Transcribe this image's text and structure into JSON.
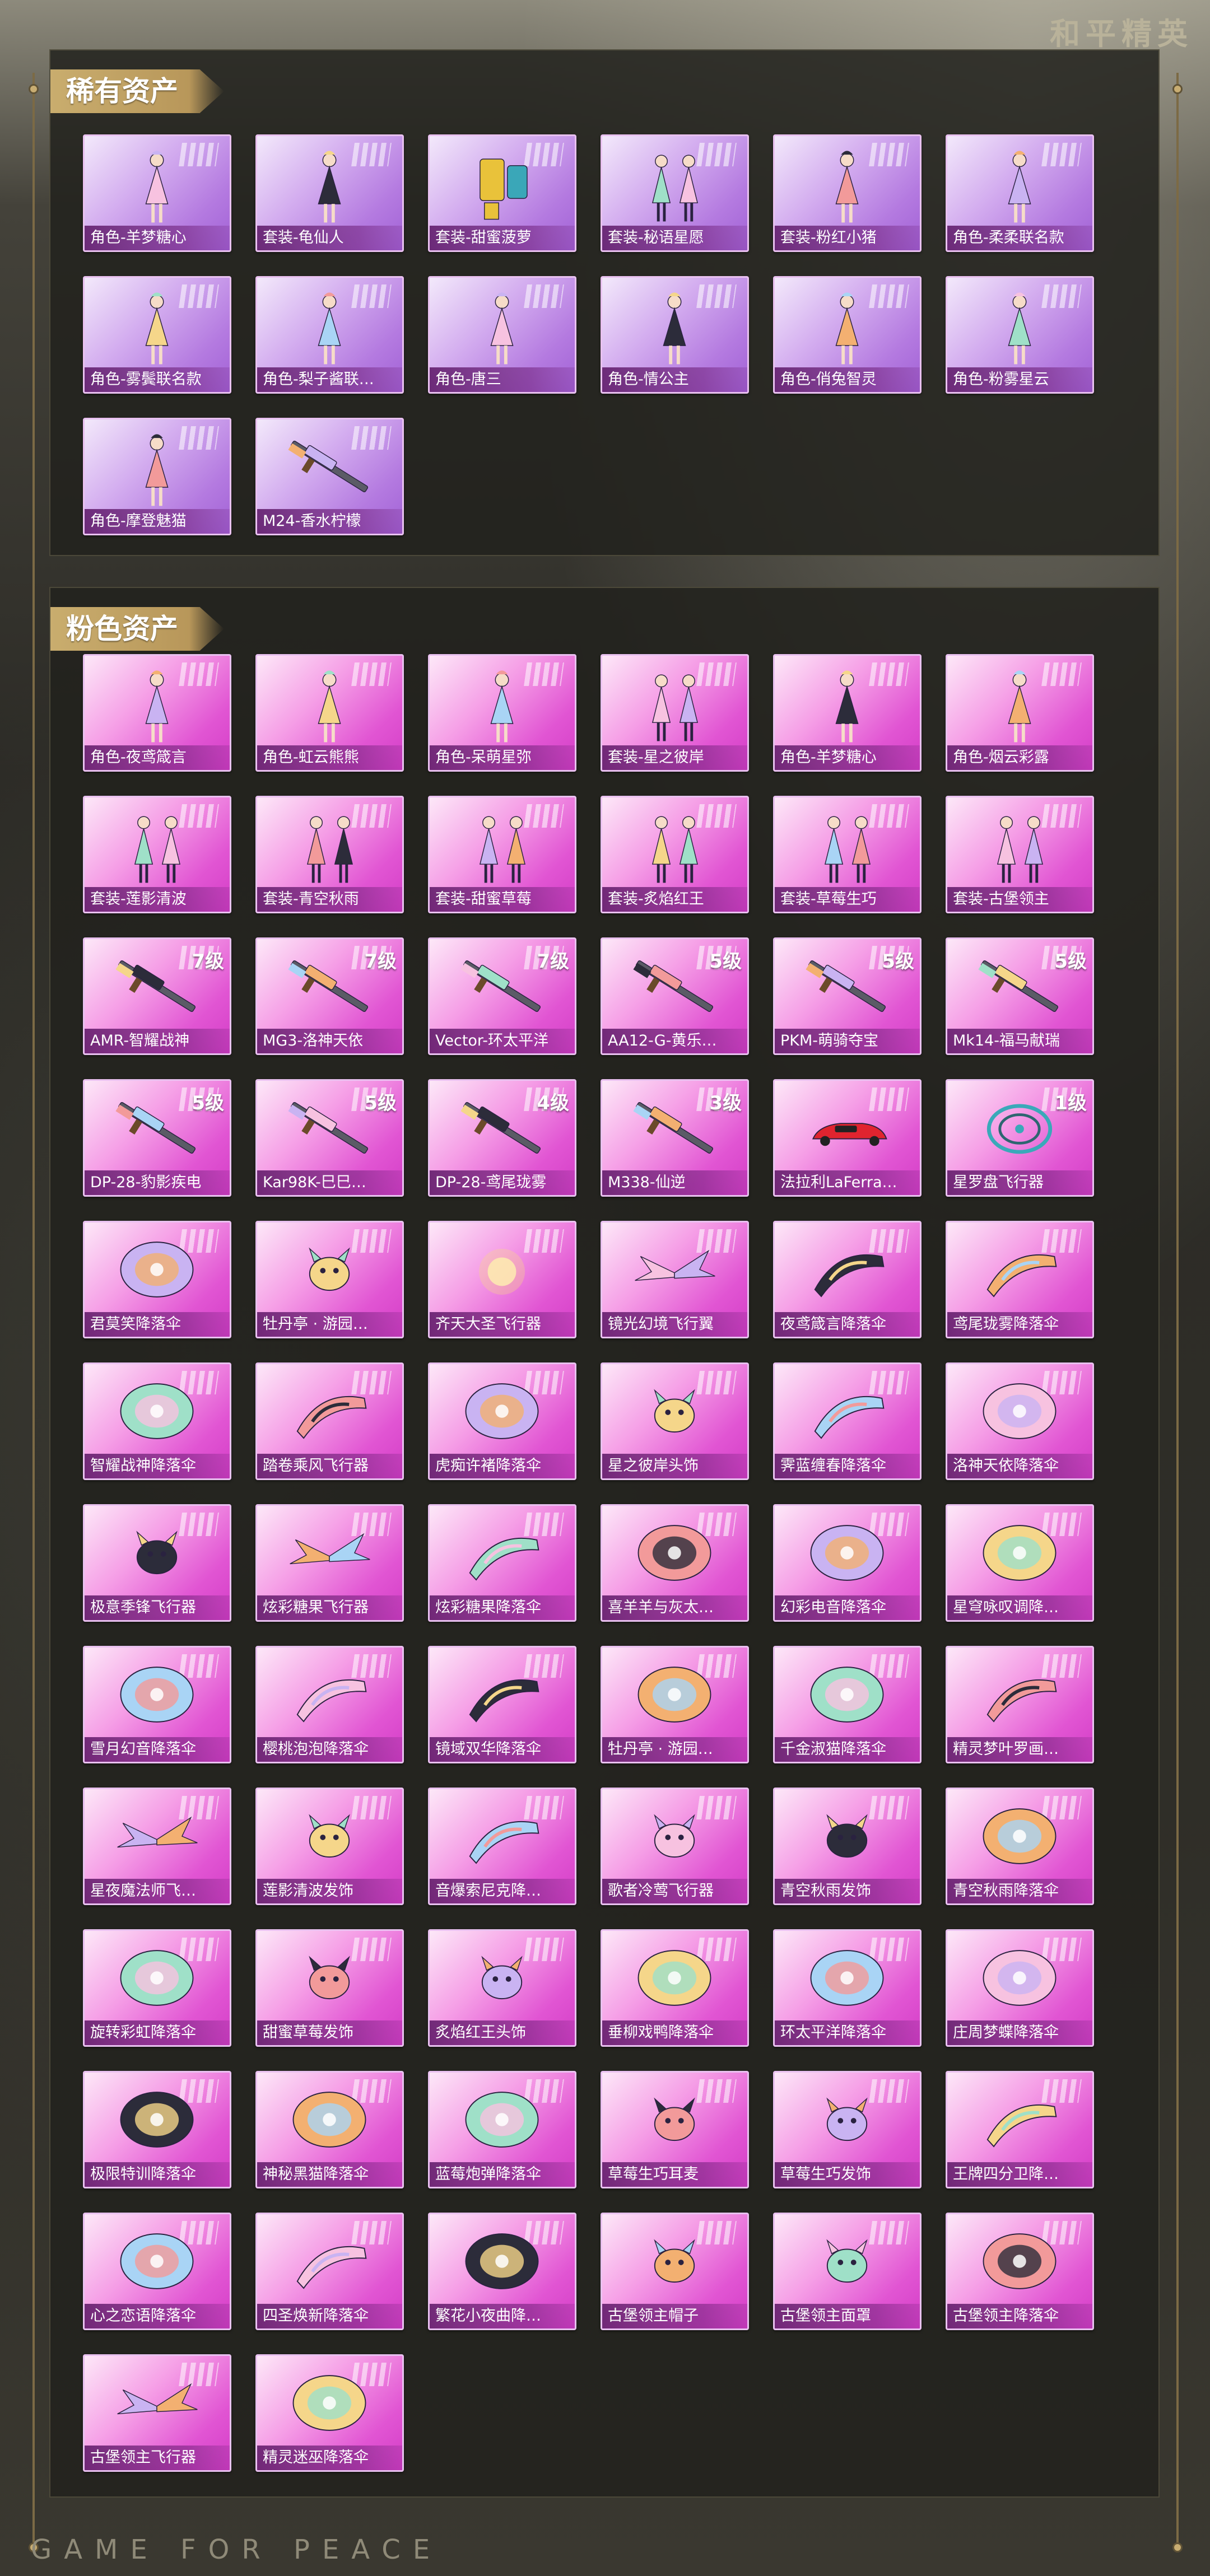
{
  "header": {
    "brand_title": "和平精英"
  },
  "footer": {
    "brand_text": "GAME FOR PEACE"
  },
  "rare_section": {
    "title": "稀有资产",
    "items": [
      {
        "label": "角色-羊梦糖心",
        "type": "character",
        "level": ""
      },
      {
        "label": "套装-龟仙人",
        "type": "character",
        "level": ""
      },
      {
        "label": "套装-甜蜜菠萝",
        "type": "outfit",
        "level": ""
      },
      {
        "label": "套装-秘语星愿",
        "type": "pair",
        "level": ""
      },
      {
        "label": "套装-粉红小猪",
        "type": "character",
        "level": ""
      },
      {
        "label": "角色-柔柔联名款",
        "type": "character",
        "level": ""
      },
      {
        "label": "角色-雾鬓联名款",
        "type": "character",
        "level": ""
      },
      {
        "label": "角色-梨子酱联…",
        "type": "character",
        "level": ""
      },
      {
        "label": "角色-唐三",
        "type": "character",
        "level": ""
      },
      {
        "label": "角色-情公主",
        "type": "character",
        "level": ""
      },
      {
        "label": "角色-俏兔智灵",
        "type": "character",
        "level": ""
      },
      {
        "label": "角色-粉雾星云",
        "type": "character",
        "level": ""
      },
      {
        "label": "角色-摩登魅猫",
        "type": "character",
        "level": ""
      },
      {
        "label": "M24-香水柠檬",
        "type": "gun",
        "level": ""
      }
    ]
  },
  "pink_section": {
    "title": "粉色资产",
    "items": [
      {
        "label": "角色-夜鸢箴言",
        "type": "character",
        "level": ""
      },
      {
        "label": "角色-虹云熊熊",
        "type": "character",
        "level": ""
      },
      {
        "label": "角色-呆萌星弥",
        "type": "character",
        "level": ""
      },
      {
        "label": "套装-星之彼岸",
        "type": "pair",
        "level": ""
      },
      {
        "label": "角色-羊梦糖心",
        "type": "character",
        "level": ""
      },
      {
        "label": "角色-烟云彩露",
        "type": "character",
        "level": ""
      },
      {
        "label": "套装-莲影清波",
        "type": "pair",
        "level": ""
      },
      {
        "label": "套装-青空秋雨",
        "type": "pair",
        "level": ""
      },
      {
        "label": "套装-甜蜜草莓",
        "type": "pair",
        "level": ""
      },
      {
        "label": "套装-炙焰红王",
        "type": "pair",
        "level": ""
      },
      {
        "label": "套装-草莓生巧",
        "type": "pair",
        "level": ""
      },
      {
        "label": "套装-古堡领主",
        "type": "pair",
        "level": ""
      },
      {
        "label": "AMR-智耀战神",
        "type": "gun",
        "level": "7级"
      },
      {
        "label": "MG3-洛神天依",
        "type": "gun",
        "level": "7级"
      },
      {
        "label": "Vector-环太平洋",
        "type": "gun",
        "level": "7级"
      },
      {
        "label": "AA12-G-黄乐…",
        "type": "gun",
        "level": "5级"
      },
      {
        "label": "PKM-萌骑夺宝",
        "type": "gun",
        "level": "5级"
      },
      {
        "label": "Mk14-福马献瑞",
        "type": "gun",
        "level": "5级"
      },
      {
        "label": "DP-28-豹影疾电",
        "type": "gun",
        "level": "5级"
      },
      {
        "label": "Kar98K-巳巳…",
        "type": "gun",
        "level": "5级"
      },
      {
        "label": "DP-28-鸢尾珑雾",
        "type": "gun",
        "level": "4级"
      },
      {
        "label": "M338-仙逆",
        "type": "gun",
        "level": "3级"
      },
      {
        "label": "法拉利LaFerra…",
        "type": "car",
        "level": ""
      },
      {
        "label": "星罗盘飞行器",
        "type": "ring",
        "level": "1级"
      },
      {
        "label": "君莫笑降落伞",
        "type": "parachute",
        "level": ""
      },
      {
        "label": "牡丹亭 · 游园…",
        "type": "creature",
        "level": ""
      },
      {
        "label": "齐天大圣飞行器",
        "type": "glow",
        "level": ""
      },
      {
        "label": "镜光幻境飞行翼",
        "type": "wing",
        "level": ""
      },
      {
        "label": "夜鸢箴言降落伞",
        "type": "glider",
        "level": ""
      },
      {
        "label": "鸢尾珑雾降落伞",
        "type": "glider",
        "level": ""
      },
      {
        "label": "智耀战神降落伞",
        "type": "parachute",
        "level": ""
      },
      {
        "label": "踏卷乘风飞行器",
        "type": "glider",
        "level": ""
      },
      {
        "label": "虎痴许褚降落伞",
        "type": "parachute",
        "level": ""
      },
      {
        "label": "星之彼岸头饰",
        "type": "creature",
        "level": ""
      },
      {
        "label": "霁蓝缠春降落伞",
        "type": "glider",
        "level": ""
      },
      {
        "label": "洛神天依降落伞",
        "type": "parachute",
        "level": ""
      },
      {
        "label": "极意季锋飞行器",
        "type": "creature",
        "level": ""
      },
      {
        "label": "炫彩糖果飞行器",
        "type": "wing",
        "level": ""
      },
      {
        "label": "炫彩糖果降落伞",
        "type": "glider",
        "level": ""
      },
      {
        "label": "喜羊羊与灰太…",
        "type": "parachute",
        "level": ""
      },
      {
        "label": "幻彩电音降落伞",
        "type": "parachute",
        "level": ""
      },
      {
        "label": "星穹咏叹调降…",
        "type": "parachute",
        "level": ""
      },
      {
        "label": "雪月幻音降落伞",
        "type": "parachute",
        "level": ""
      },
      {
        "label": "樱桃泡泡降落伞",
        "type": "glider",
        "level": ""
      },
      {
        "label": "镜域双华降落伞",
        "type": "glider",
        "level": ""
      },
      {
        "label": "牡丹亭 · 游园…",
        "type": "parachute",
        "level": ""
      },
      {
        "label": "千金淑猫降落伞",
        "type": "parachute",
        "level": ""
      },
      {
        "label": "精灵梦叶罗画…",
        "type": "glider",
        "level": ""
      },
      {
        "label": "星夜魔法师飞…",
        "type": "wing",
        "level": ""
      },
      {
        "label": "莲影清波发饰",
        "type": "creature",
        "level": ""
      },
      {
        "label": "音爆索尼克降…",
        "type": "glider",
        "level": ""
      },
      {
        "label": "歌者冷莺飞行器",
        "type": "creature",
        "level": ""
      },
      {
        "label": "青空秋雨发饰",
        "type": "creature",
        "level": ""
      },
      {
        "label": "青空秋雨降落伞",
        "type": "parachute",
        "level": ""
      },
      {
        "label": "旋转彩虹降落伞",
        "type": "parachute",
        "level": ""
      },
      {
        "label": "甜蜜草莓发饰",
        "type": "creature",
        "level": ""
      },
      {
        "label": "炙焰红王头饰",
        "type": "creature",
        "level": ""
      },
      {
        "label": "垂柳戏鸭降落伞",
        "type": "parachute",
        "level": ""
      },
      {
        "label": "环太平洋降落伞",
        "type": "parachute",
        "level": ""
      },
      {
        "label": "庄周梦蝶降落伞",
        "type": "parachute",
        "level": ""
      },
      {
        "label": "极限特训降落伞",
        "type": "parachute",
        "level": ""
      },
      {
        "label": "神秘黑猫降落伞",
        "type": "parachute",
        "level": ""
      },
      {
        "label": "蓝莓炮弹降落伞",
        "type": "parachute",
        "level": ""
      },
      {
        "label": "草莓生巧耳麦",
        "type": "creature",
        "level": ""
      },
      {
        "label": "草莓生巧发饰",
        "type": "creature",
        "level": ""
      },
      {
        "label": "王牌四分卫降…",
        "type": "glider",
        "level": ""
      },
      {
        "label": "心之恋语降落伞",
        "type": "parachute",
        "level": ""
      },
      {
        "label": "四圣焕新降落伞",
        "type": "glider",
        "level": ""
      },
      {
        "label": "繁花小夜曲降…",
        "type": "parachute",
        "level": ""
      },
      {
        "label": "古堡领主帽子",
        "type": "creature",
        "level": ""
      },
      {
        "label": "古堡领主面罩",
        "type": "creature",
        "level": ""
      },
      {
        "label": "古堡领主降落伞",
        "type": "parachute",
        "level": ""
      },
      {
        "label": "古堡领主飞行器",
        "type": "wing",
        "level": ""
      },
      {
        "label": "精灵迷巫降落伞",
        "type": "parachute",
        "level": ""
      }
    ]
  }
}
